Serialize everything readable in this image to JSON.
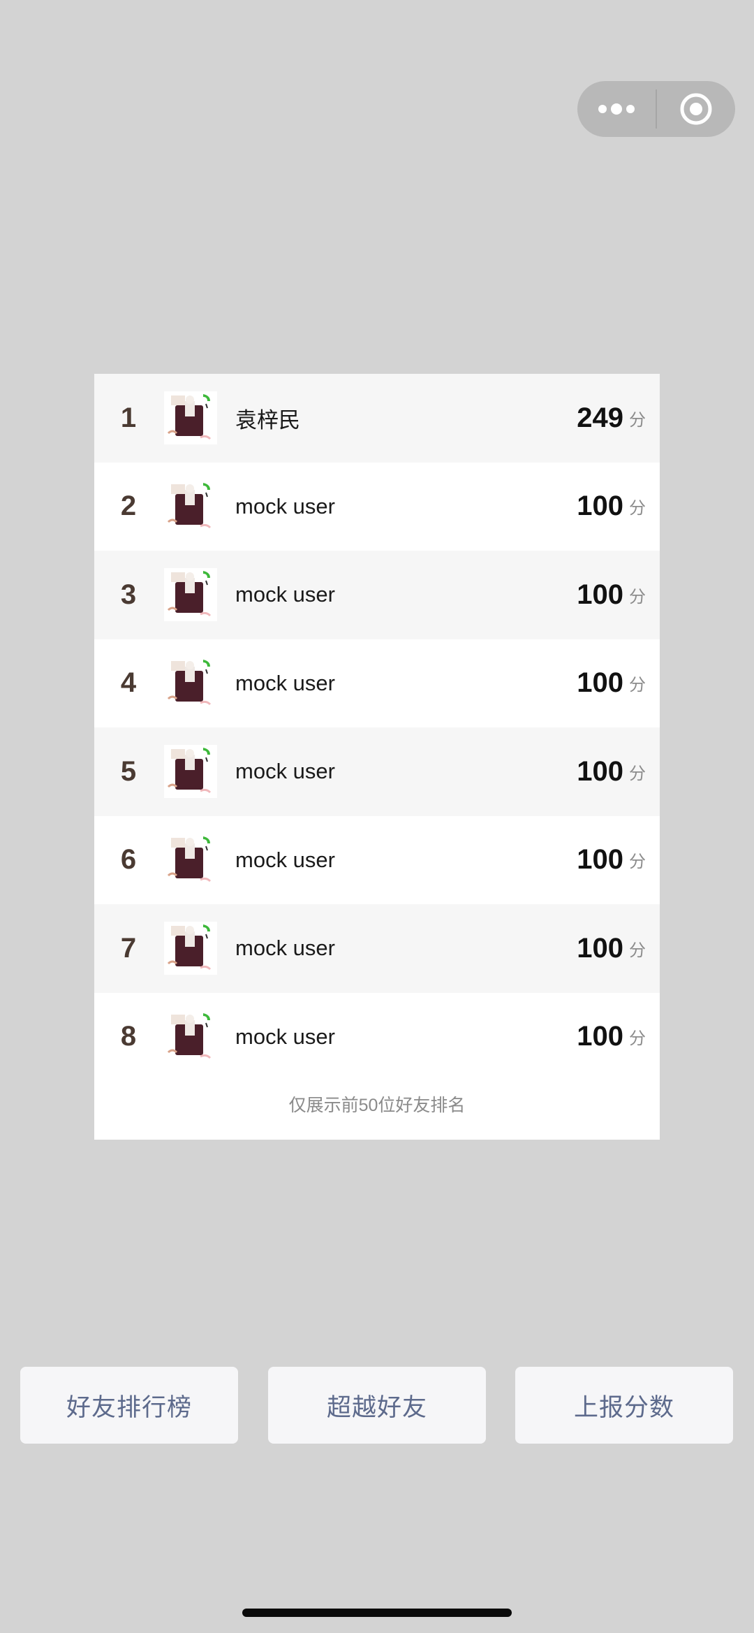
{
  "capsule": {
    "more_icon": "more-dots-icon",
    "close_icon": "target-circle-icon"
  },
  "ranking": {
    "rows": [
      {
        "rank": "1",
        "name": "袁梓民",
        "score": "249",
        "unit": "分"
      },
      {
        "rank": "2",
        "name": "mock user",
        "score": "100",
        "unit": "分"
      },
      {
        "rank": "3",
        "name": "mock user",
        "score": "100",
        "unit": "分"
      },
      {
        "rank": "4",
        "name": "mock user",
        "score": "100",
        "unit": "分"
      },
      {
        "rank": "5",
        "name": "mock user",
        "score": "100",
        "unit": "分"
      },
      {
        "rank": "6",
        "name": "mock user",
        "score": "100",
        "unit": "分"
      },
      {
        "rank": "7",
        "name": "mock user",
        "score": "100",
        "unit": "分"
      },
      {
        "rank": "8",
        "name": "mock user",
        "score": "100",
        "unit": "分"
      }
    ],
    "footer_note": "仅展示前50位好友排名"
  },
  "actions": {
    "friend_rank_label": "好友排行榜",
    "surpass_friends_label": "超越好友",
    "report_score_label": "上报分数"
  },
  "colors": {
    "background": "#d3d3d3",
    "panel": "#ffffff",
    "row_alt": "#f6f6f6",
    "rank_text": "#4a3a32",
    "button_text": "#5d6a8c"
  }
}
